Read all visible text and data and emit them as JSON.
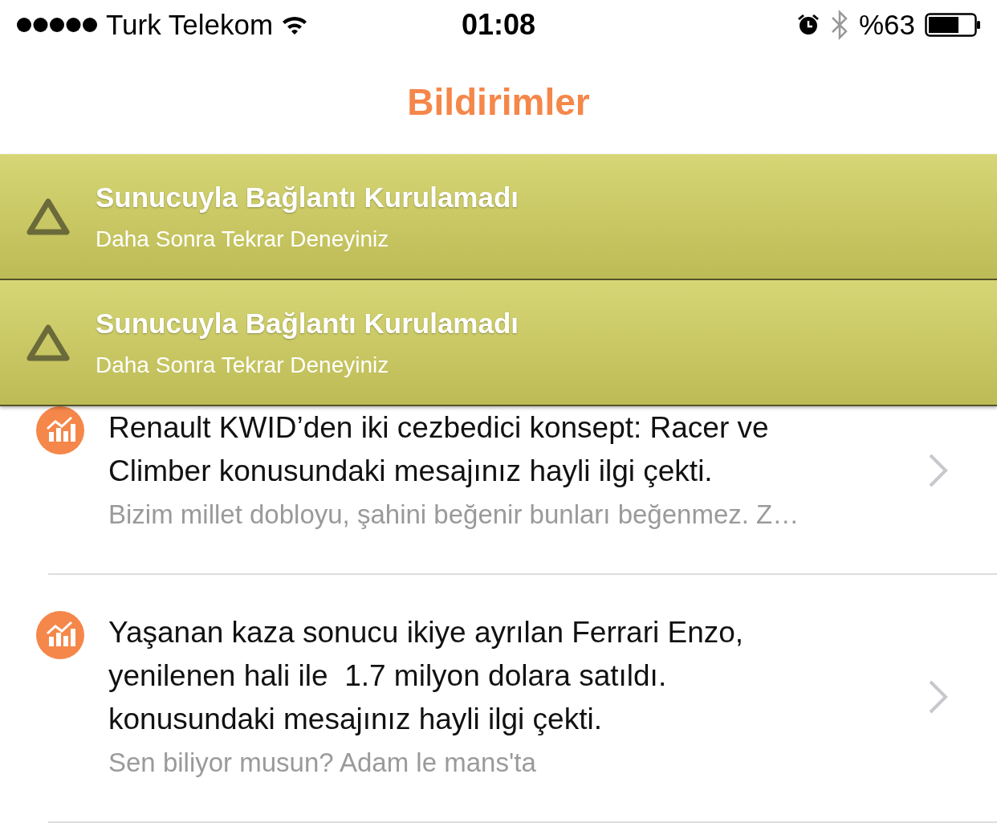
{
  "status_bar": {
    "carrier": "Turk Telekom",
    "time": "01:08",
    "battery": "%63"
  },
  "nav": {
    "title": "Bildirimler"
  },
  "notifications": [
    {
      "title": "Renault KWID’den iki cezbedici konsept: Racer ve Climber konusundaki mesajınız hayli ilgi çekti.",
      "subtitle": "Bizim millet dobloyu, şahini beğenir bunları beğenmez. Z…"
    },
    {
      "title": "Yaşanan kaza sonucu ikiye ayrılan Ferrari Enzo, yenilenen hali ile  1.7 milyon dolara satıldı. konusundaki mesajınız hayli ilgi çekti.",
      "subtitle": "Sen biliyor musun? Adam le mans'ta"
    }
  ],
  "alerts": [
    {
      "title": "Sunucuyla Bağlantı Kurulamadı",
      "message": "Daha Sonra Tekrar Deneyiniz"
    },
    {
      "title": "Sunucuyla Bağlantı Kurulamadı",
      "message": "Daha Sonra Tekrar Deneyiniz"
    }
  ]
}
